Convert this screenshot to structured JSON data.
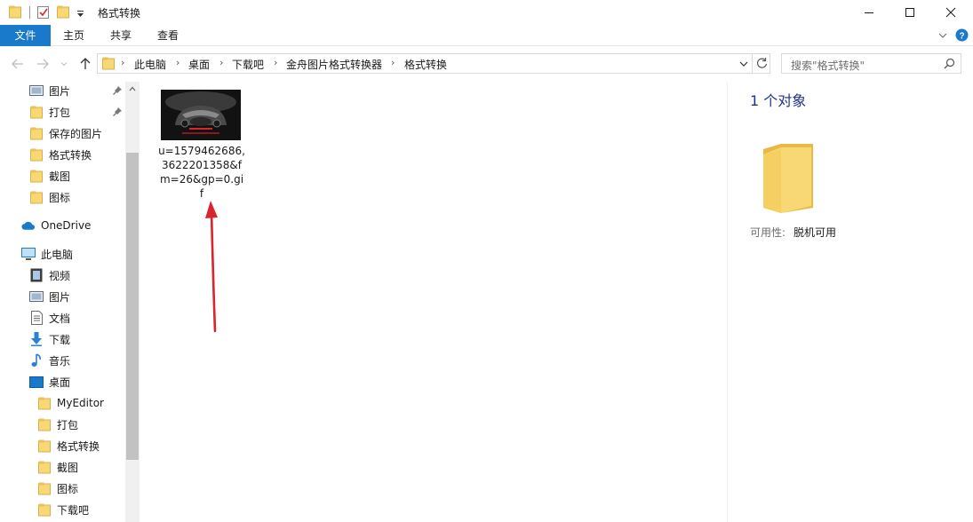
{
  "window": {
    "title": "格式转换"
  },
  "ribbon": {
    "tabs": [
      {
        "label": "文件"
      },
      {
        "label": "主页"
      },
      {
        "label": "共享"
      },
      {
        "label": "查看"
      }
    ]
  },
  "address": {
    "crumbs": [
      "此电脑",
      "桌面",
      "下载吧",
      "金舟图片格式转换器",
      "格式转换"
    ],
    "search_placeholder": "搜索\"格式转换\""
  },
  "nav": {
    "quick_access": [
      {
        "label": "图片",
        "icon": "pictures-icon",
        "pinned": true
      },
      {
        "label": "打包",
        "icon": "folder-icon",
        "pinned": true
      },
      {
        "label": "保存的图片",
        "icon": "folder-icon",
        "pinned": false
      },
      {
        "label": "格式转换",
        "icon": "folder-icon",
        "pinned": false
      },
      {
        "label": "截图",
        "icon": "folder-icon",
        "pinned": false
      },
      {
        "label": "图标",
        "icon": "folder-icon",
        "pinned": false
      }
    ],
    "onedrive": {
      "label": "OneDrive",
      "icon": "cloud-icon"
    },
    "this_pc": {
      "label": "此电脑",
      "icon": "computer-icon"
    },
    "pc_items": [
      {
        "label": "视频",
        "icon": "video-icon"
      },
      {
        "label": "图片",
        "icon": "pictures-icon"
      },
      {
        "label": "文档",
        "icon": "document-icon"
      },
      {
        "label": "下载",
        "icon": "download-icon"
      },
      {
        "label": "音乐",
        "icon": "music-icon"
      },
      {
        "label": "桌面",
        "icon": "desktop-icon"
      }
    ],
    "desktop_items": [
      {
        "label": "MyEditor",
        "icon": "folder-icon"
      },
      {
        "label": "打包",
        "icon": "folder-icon"
      },
      {
        "label": "格式转换",
        "icon": "folder-icon"
      },
      {
        "label": "截图",
        "icon": "folder-icon"
      },
      {
        "label": "图标",
        "icon": "folder-icon"
      },
      {
        "label": "下载吧",
        "icon": "folder-icon"
      }
    ]
  },
  "content": {
    "file": {
      "name_lines": [
        "u=1579462686,",
        "3622201358&f",
        "m=26&gp=0.gi",
        "f"
      ]
    }
  },
  "details": {
    "count": "1 个对象",
    "availability_label": "可用性:",
    "availability_value": "脱机可用"
  },
  "colors": {
    "accent": "#1979ca",
    "folder": "#f8d775",
    "arrow": "#d9252b",
    "count_text": "#1e3287"
  }
}
